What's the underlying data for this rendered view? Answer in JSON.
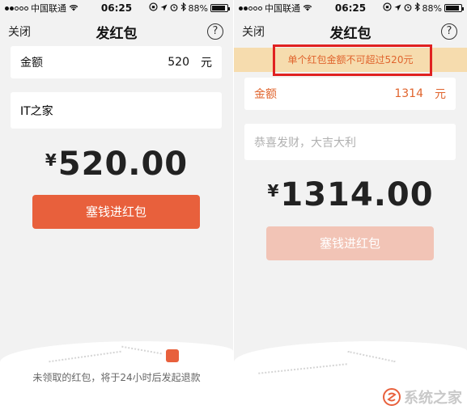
{
  "status_bar": {
    "carrier": "中国联通",
    "time": "06:25",
    "battery": "88%",
    "battery_level": 0.88
  },
  "left": {
    "nav": {
      "close": "关闭",
      "title": "发红包",
      "help": "?"
    },
    "amount_field": {
      "label": "金额",
      "value": "520",
      "unit": "元"
    },
    "message_field": {
      "value": "IT之家"
    },
    "total": {
      "currency": "¥",
      "value": "520.00"
    },
    "send_button": {
      "label": "塞钱进红包",
      "color": "#e8603c"
    },
    "footer_note": "未领取的红包，将于24小时后发起退款"
  },
  "right": {
    "nav": {
      "close": "关闭",
      "title": "发红包",
      "help": "?"
    },
    "warning": "单个红包金额不可超过520元",
    "amount_field": {
      "label": "金额",
      "value": "1314",
      "unit": "元",
      "color": "#e0642d"
    },
    "message_field": {
      "placeholder": "恭喜发财，大吉大利"
    },
    "total": {
      "currency": "¥",
      "value": "1314.00"
    },
    "send_button": {
      "label": "塞钱进红包",
      "color": "#f2c4b6"
    }
  },
  "watermark": {
    "text": "系统之家",
    "icon": "xitongzhijia-logo-icon"
  }
}
